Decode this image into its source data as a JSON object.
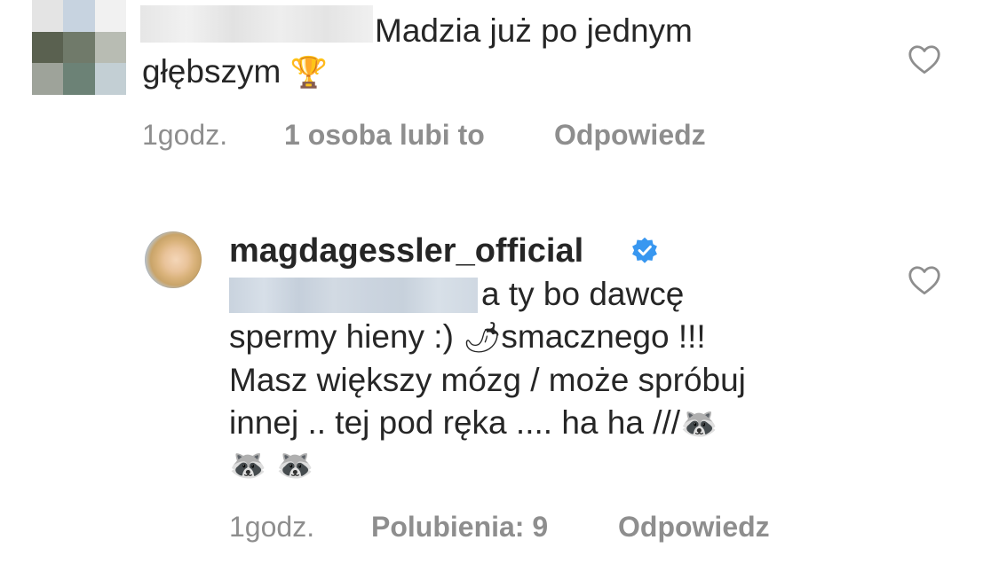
{
  "comments": [
    {
      "username_redacted": true,
      "text_line1": "Madzia już po jednym",
      "text_line2": "głębszym",
      "emoji_1": "🏆",
      "time": "1godz.",
      "likes": "1 osoba lubi to",
      "reply": "Odpowiedz"
    },
    {
      "username": "magdagessler_official",
      "verified": true,
      "mention_redacted": true,
      "text_line1": "a ty bo dawcę",
      "text_line2a": "spermy hieny :)",
      "emoji_chili": "🌶",
      "text_line2b": "smacznego !!!",
      "text_line3": "Masz większy mózg / może spróbuj",
      "text_line4": "innej .. tej pod ręka .... ha ha ///",
      "emoji_raccoon": "🦝",
      "emoji_raccoons_line": "🦝 🦝",
      "time": "1godz.",
      "likes": "Polubienia: 9",
      "reply": "Odpowiedz"
    }
  ],
  "icons": {
    "heart": "heart-outline-icon",
    "verified": "verified-badge-icon"
  },
  "colors": {
    "text": "#262626",
    "meta": "#8e8e8e",
    "verified": "#3897f0"
  }
}
